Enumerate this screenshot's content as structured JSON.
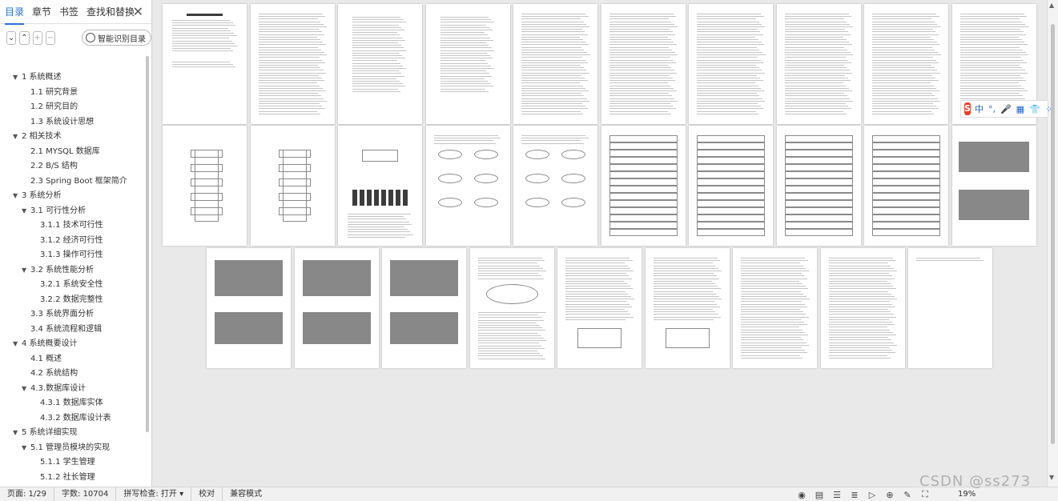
{
  "sidebar": {
    "tabs": [
      {
        "label": "目录",
        "active": true
      },
      {
        "label": "章节",
        "active": false
      },
      {
        "label": "书签",
        "active": false
      },
      {
        "label": "查找和替换",
        "active": false
      }
    ],
    "close_label": "✕",
    "toolbar": {
      "collapse_icon": "chevron-down-icon",
      "expand_icon": "chevron-up-icon",
      "add_icon": "plus-icon",
      "remove_icon": "minus-icon",
      "smart_label": "智能识别目录"
    },
    "toc": [
      {
        "label": "1 系统概述",
        "level": 1,
        "arrow": true
      },
      {
        "label": "1.1  研究背景",
        "level": 2
      },
      {
        "label": "1.2 研究目的",
        "level": 2
      },
      {
        "label": "1.3 系统设计思想",
        "level": 2
      },
      {
        "label": "2 相关技术",
        "level": 1,
        "arrow": true
      },
      {
        "label": "2.1 MYSQL 数据库",
        "level": 2
      },
      {
        "label": "2.2 B/S 结构",
        "level": 2
      },
      {
        "label": "2.3 Spring Boot 框架简介",
        "level": 2
      },
      {
        "label": "3 系统分析",
        "level": 1,
        "arrow": true
      },
      {
        "label": "3.1 可行性分析",
        "level": 2,
        "arrow": true
      },
      {
        "label": "3.1.1 技术可行性",
        "level": 3
      },
      {
        "label": "3.1.2 经济可行性",
        "level": 3
      },
      {
        "label": "3.1.3 操作可行性",
        "level": 3
      },
      {
        "label": "3.2 系统性能分析",
        "level": 2,
        "arrow": true
      },
      {
        "label": "3.2.1  系统安全性",
        "level": 3
      },
      {
        "label": "3.2.2  数据完整性",
        "level": 3
      },
      {
        "label": "3.3 系统界面分析",
        "level": 2
      },
      {
        "label": "3.4 系统流程和逻辑",
        "level": 2
      },
      {
        "label": "4 系统概要设计",
        "level": 1,
        "arrow": true
      },
      {
        "label": "4.1 概述",
        "level": 2
      },
      {
        "label": "4.2 系统结构",
        "level": 2
      },
      {
        "label": "4.3.数据库设计",
        "level": 2,
        "arrow": true
      },
      {
        "label": "4.3.1 数据库实体",
        "level": 3
      },
      {
        "label": "4.3.2 数据库设计表",
        "level": 3
      },
      {
        "label": "5 系统详细实现",
        "level": 1,
        "arrow": true
      },
      {
        "label": "5.1  管理员模块的实现",
        "level": 2,
        "arrow": true
      },
      {
        "label": "5.1.1  学生管理",
        "level": 3
      },
      {
        "label": "5.1.2  社长管理",
        "level": 3
      }
    ]
  },
  "ime": {
    "logo": "S",
    "items": [
      "中",
      "°,",
      "🎤",
      "▦",
      "👕",
      "⁘"
    ]
  },
  "status": {
    "page": "页面: 1/29",
    "words": "字数: 10704",
    "spell": "拼写检查: 打开 ▾",
    "proof": "校对",
    "compat": "兼容模式",
    "zoom": "19%",
    "icons": [
      "eye-icon",
      "page-view-icon",
      "outline-view-icon",
      "list-view-icon",
      "play-icon",
      "web-icon",
      "pen-icon",
      "fit-icon"
    ]
  },
  "watermark": "CSDN @ss273"
}
